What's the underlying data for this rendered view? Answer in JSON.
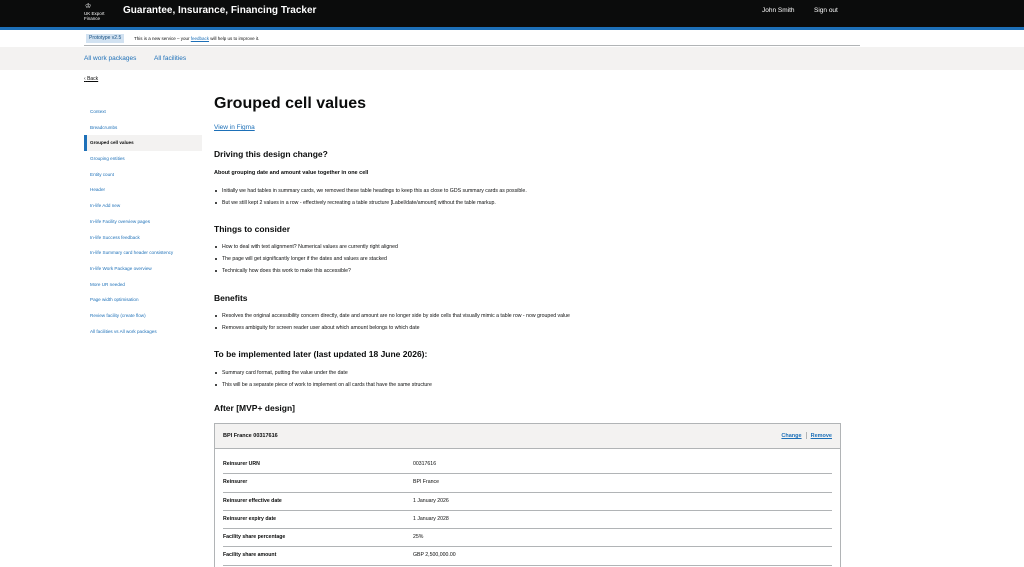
{
  "header": {
    "logo_text": "UK Export Finance",
    "service_name": "Guarantee, Insurance, Financing Tracker",
    "user_name": "John Smith",
    "sign_out": "Sign out"
  },
  "phase_banner": {
    "tag": "Prototype v2.5",
    "text_before": "This is a new service – your ",
    "link": "feedback",
    "text_after": " will help us to improve it."
  },
  "subnav": {
    "items": [
      "All work packages",
      "All facilities"
    ]
  },
  "back_link": "Back",
  "sidenav": {
    "items": [
      "Context",
      "Breadcrumbs",
      "Grouped cell values",
      "Grouping entities",
      "Entity count",
      "Header",
      "In-life Add new",
      "In-life Facility overview pages",
      "In-life Success feedback",
      "In-life Summary card header consistency",
      "In-life Work Package overview",
      "More UR needed",
      "Page width optimisation",
      "Review facility (create flow)",
      "All facilities vs All work packages"
    ],
    "active_index": 2
  },
  "main": {
    "title": "Grouped cell values",
    "figma_link": "View in Figma",
    "driving": {
      "heading": "Driving this design change?",
      "subheading": "About grouping date and amount value together in one cell",
      "items": [
        "Initially we had tables in summary cards, we removed these table headings to keep this as close to GDS summary cards as possible.",
        "But we still kept 2 values in a row - effectively recreating a table structure [Label/date/amount] without the table markup."
      ]
    },
    "consider": {
      "heading": "Things to consider",
      "items": [
        "How to deal with text alignment? Numerical values are currently right aligned",
        "The page will get significantly longer if the dates and values are stacked",
        "Technically how does this work to make this accessible?"
      ]
    },
    "benefits": {
      "heading": "Benefits",
      "items": [
        "Resolves the original accessibility concern directly, date and amount are no longer side by side cells that visually mimic a table row - now grouped value",
        "Removes ambiguity for screen reader user about which amount belongs to which date"
      ]
    },
    "later": {
      "heading": "To be implemented later (last updated 18 June 2026):",
      "items": [
        "Summary card format, putting the value under the date",
        "This will be a separate piece of work to implement on all cards that have the same structure"
      ]
    },
    "after_heading": "After [MVP+ design]"
  },
  "card": {
    "title": "BPI France 00317616",
    "change": "Change",
    "remove": "Remove",
    "rows": [
      {
        "key": "Reinsurer URN",
        "value": "00317616"
      },
      {
        "key": "Reinsurer",
        "value": "BPI France"
      },
      {
        "key": "Reinsurer effective date",
        "value": "1 January 2026"
      },
      {
        "key": "Reinsurer expiry date",
        "value": "1 January 2028"
      },
      {
        "key": "Facility share percentage",
        "value": "25%"
      },
      {
        "key": "Facility share amount",
        "value": "GBP 2,500,000.00"
      }
    ]
  },
  "colors": {
    "header_bg": "#0b0c0c",
    "link": "#1d70b8",
    "subnav_bg": "#f3f2f1",
    "border": "#b1b4b6"
  }
}
